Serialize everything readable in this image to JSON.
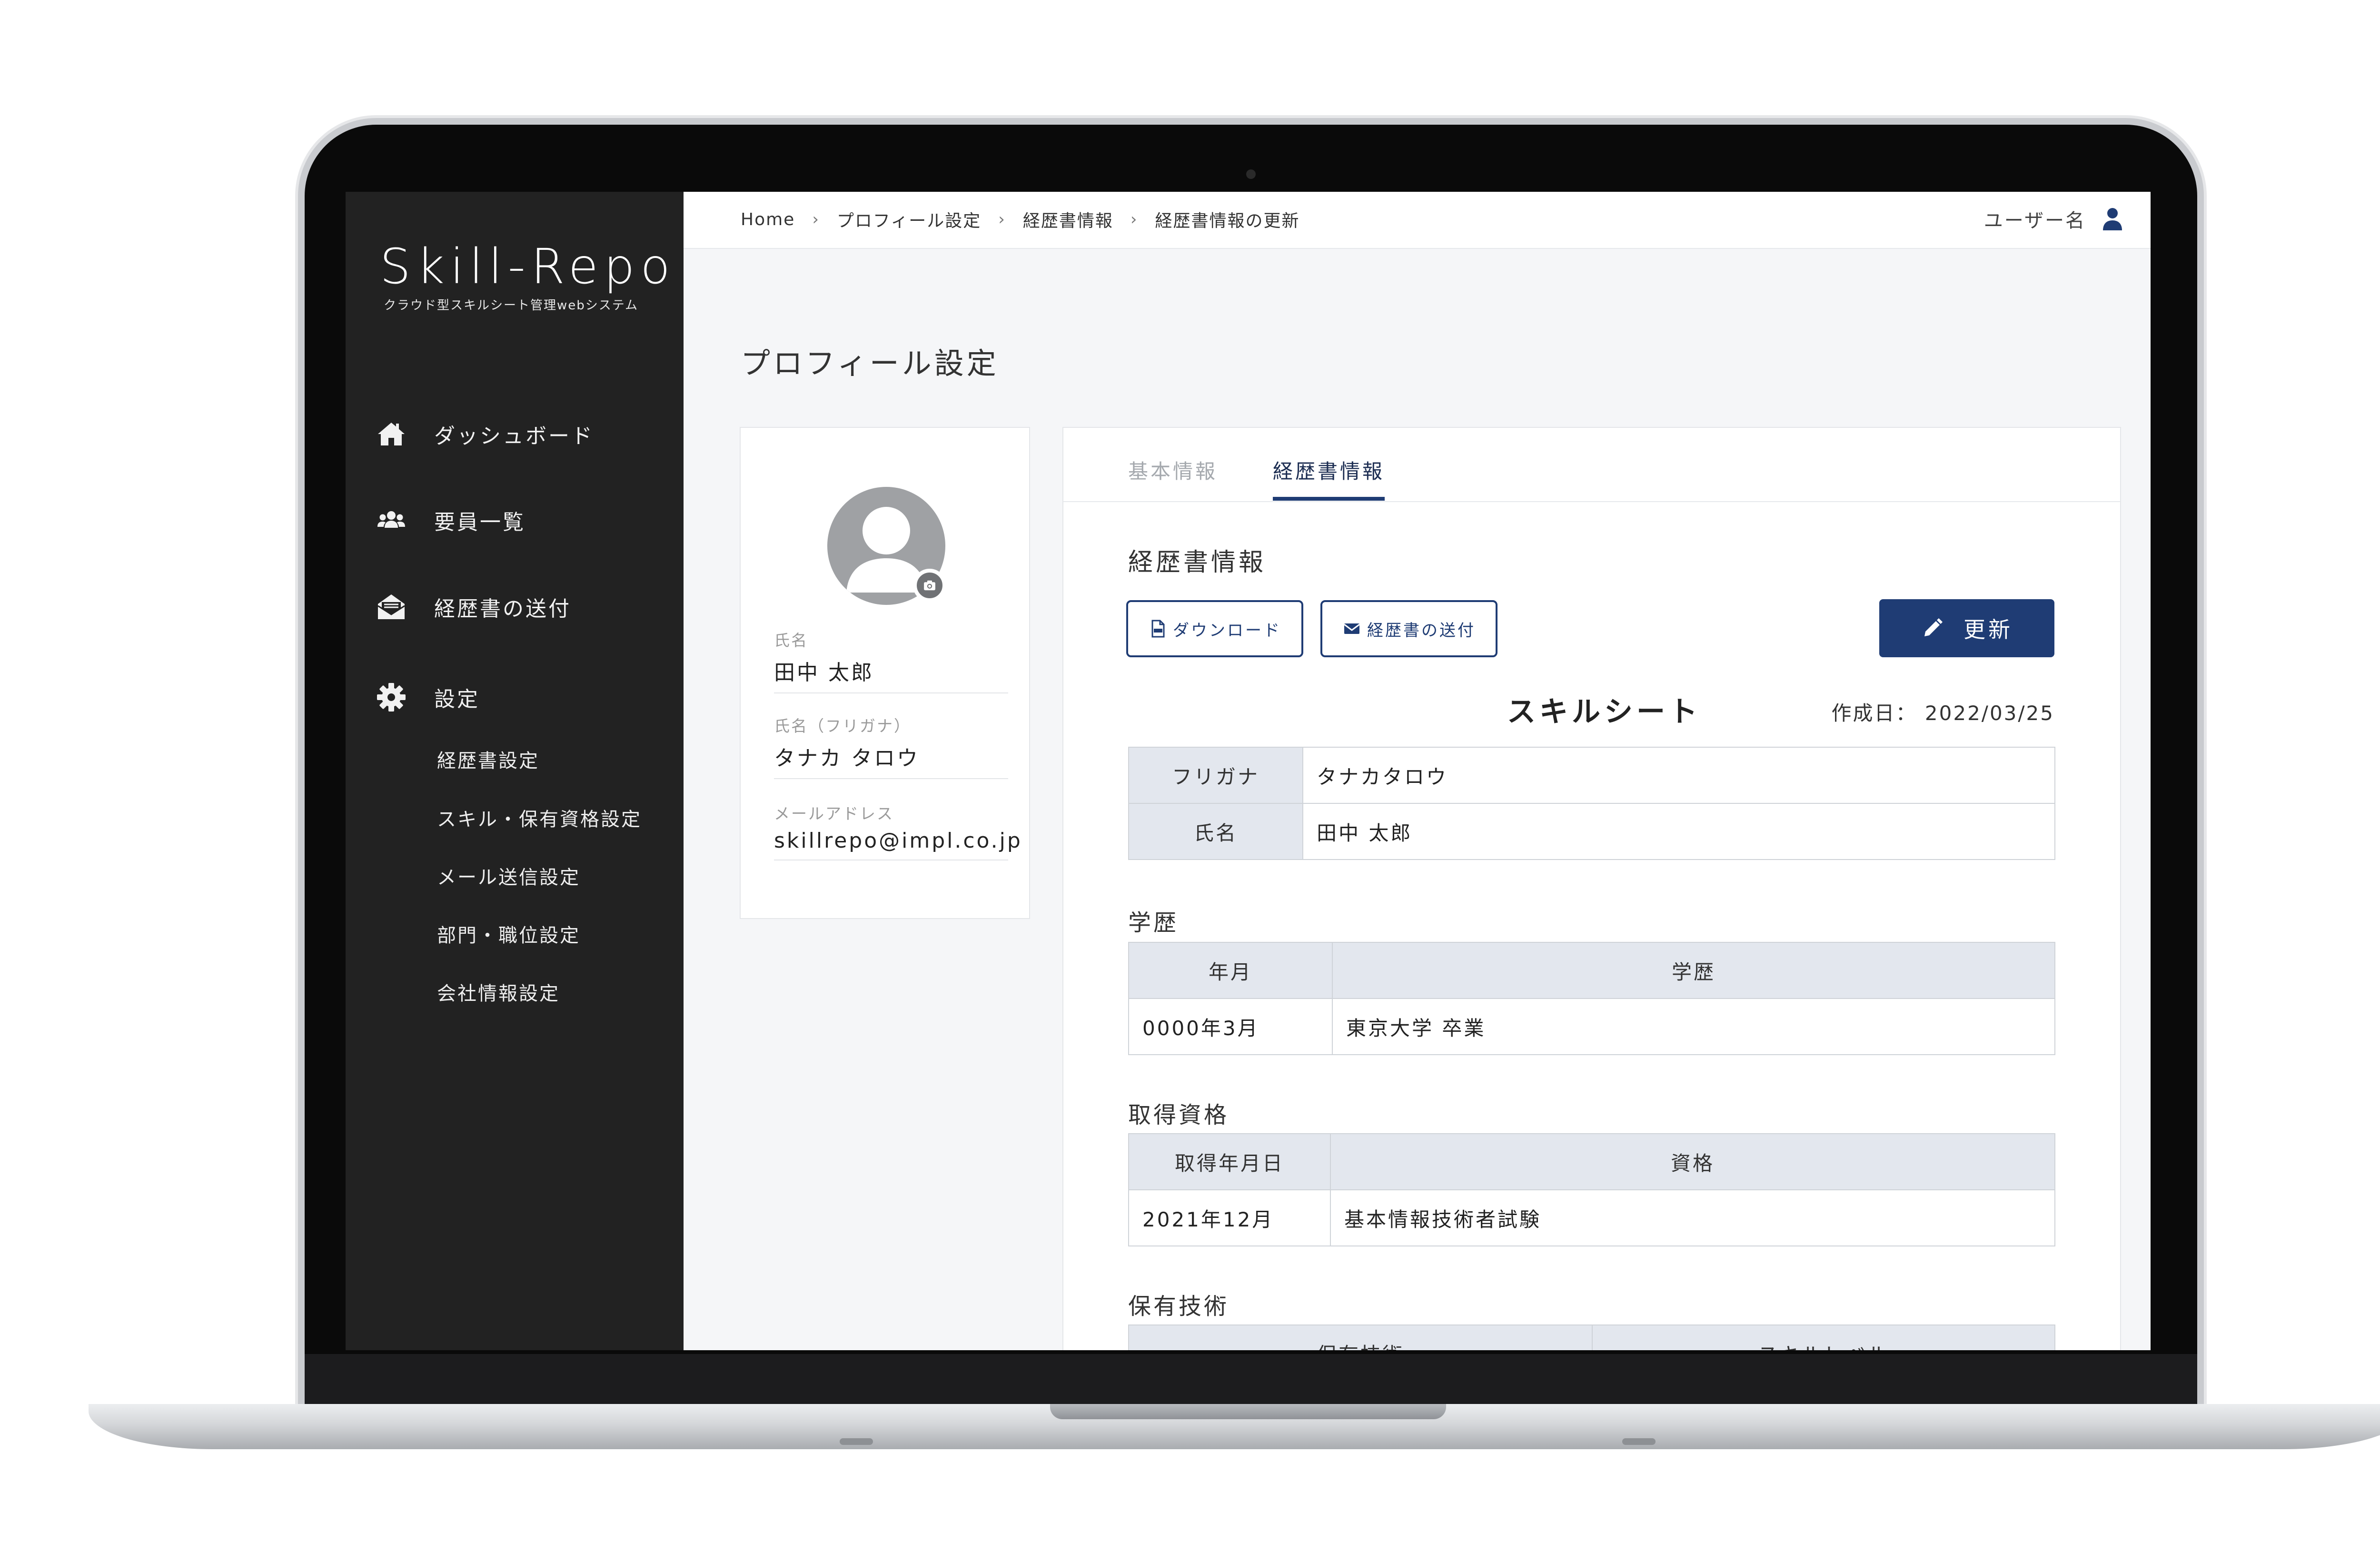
{
  "app": {
    "brand": "Skill-Repo",
    "brand_subtitle": "クラウド型スキルシート管理webシステム"
  },
  "sidebar": {
    "items": [
      {
        "label": "ダッシュボード",
        "icon": "home-icon"
      },
      {
        "label": "要員一覧",
        "icon": "users-icon"
      },
      {
        "label": "経歴書の送付",
        "icon": "mail-open-icon"
      },
      {
        "label": "設定",
        "icon": "gear-icon"
      }
    ],
    "settings_items": [
      "経歴書設定",
      "スキル・保有資格設定",
      "メール送信設定",
      "部門・職位設定",
      "会社情報設定"
    ]
  },
  "header": {
    "breadcrumbs": [
      "Home",
      "プロフィール設定",
      "経歴書情報",
      "経歴書情報の更新"
    ],
    "separator": "›",
    "user_label": "ユーザー名"
  },
  "page": {
    "title": "プロフィール設定"
  },
  "profile": {
    "fields": [
      {
        "label": "氏名",
        "value": "田中 太郎"
      },
      {
        "label": "氏名（フリガナ）",
        "value": "タナカ タロウ"
      },
      {
        "label": "メールアドレス",
        "value": "skillrepo@impl.co.jp"
      }
    ]
  },
  "tabs": [
    {
      "label": "基本情報",
      "active": false
    },
    {
      "label": "経歴書情報",
      "active": true
    }
  ],
  "resume": {
    "section_title": "経歴書情報",
    "download_label": "ダウンロード",
    "send_label": "経歴書の送付",
    "update_label": "更新",
    "sheet_title": "スキルシート",
    "created_label": "作成日：",
    "created_date": "2022/03/25",
    "furigana_key": "フリガナ",
    "furigana_value": "タナカタロウ",
    "name_key": "氏名",
    "name_value": "田中 太郎",
    "education": {
      "title": "学歴",
      "headers": [
        "年月",
        "学歴"
      ],
      "rows": [
        {
          "date": "0000年3月",
          "text": "東京大学 卒業"
        }
      ]
    },
    "qualifications": {
      "title": "取得資格",
      "headers": [
        "取得年月日",
        "資格"
      ],
      "rows": [
        {
          "date": "2021年12月",
          "text": "基本情報技術者試験"
        }
      ]
    },
    "skills": {
      "title": "保有技術",
      "headers": [
        "保有技術",
        "スキルレベル"
      ]
    }
  },
  "colors": {
    "sidebar_bg": "#222222",
    "accent": "#1f3c74",
    "table_header_bg": "#e3e7ee",
    "content_bg": "#f5f6f8"
  }
}
